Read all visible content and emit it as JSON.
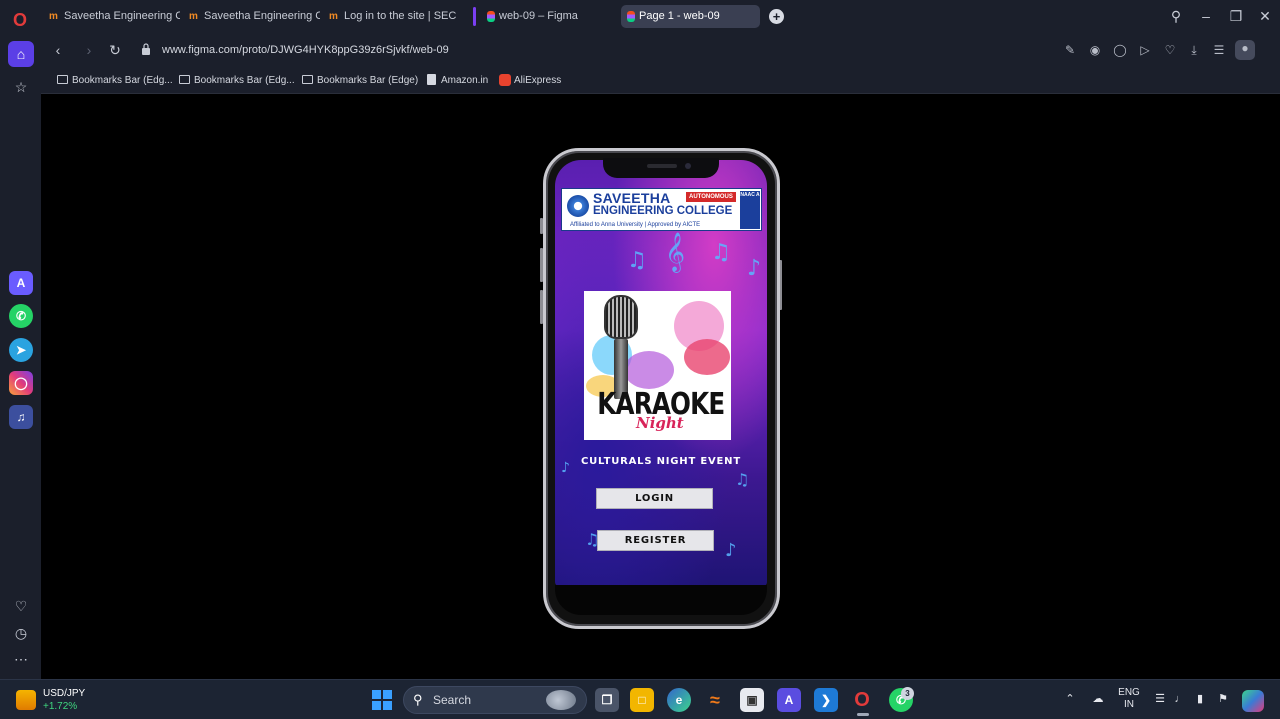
{
  "browser": {
    "tabs": [
      {
        "label": "Saveetha Engineering Coll",
        "icon": "moodle-icon"
      },
      {
        "label": "Saveetha Engineering Coll",
        "icon": "moodle-icon"
      },
      {
        "label": "Log in to the site | SEC",
        "icon": "moodle-icon"
      },
      {
        "label": "web-09 – Figma",
        "icon": "figma-icon"
      },
      {
        "label": "Page 1 - web-09",
        "icon": "figma-icon",
        "active": true
      }
    ],
    "url": "www.figma.com/proto/DJWG4HYK8ppG39z6rSjvkf/web-09",
    "bookmarks": [
      {
        "label": "Bookmarks Bar (Edg...",
        "icon": "folder-icon"
      },
      {
        "label": "Bookmarks Bar (Edg...",
        "icon": "folder-icon"
      },
      {
        "label": "Bookmarks Bar (Edge)",
        "icon": "folder-icon"
      },
      {
        "label": "Amazon.in",
        "icon": "page-icon"
      },
      {
        "label": "AliExpress",
        "icon": "aliexpress-icon"
      }
    ]
  },
  "app": {
    "college": {
      "name_line1": "SAVEETHA",
      "name_line2": "ENGINEERING COLLEGE",
      "subtitle": "Affiliated to Anna University | Approved by AICTE",
      "badge": "AUTONOMOUS",
      "naac": "NAAC A"
    },
    "poster": {
      "title": "KARAOKE",
      "subtitle": "Night"
    },
    "event_text": "CULTURALS  NIGHT EVENT",
    "login_label": "LOGIN",
    "register_label": "REGISTER"
  },
  "taskbar": {
    "ticker_label": "USD/JPY",
    "ticker_value": "+1.72%",
    "search_placeholder": "Search",
    "whatsapp_badge": "3",
    "lang_line1": "ENG",
    "lang_line2": "IN"
  },
  "colors": {
    "accent": "#5b3fe6",
    "browser_bg": "#1b1f2b",
    "taskbar_bg": "#1c2433",
    "ticker_positive": "#3fd67f"
  }
}
